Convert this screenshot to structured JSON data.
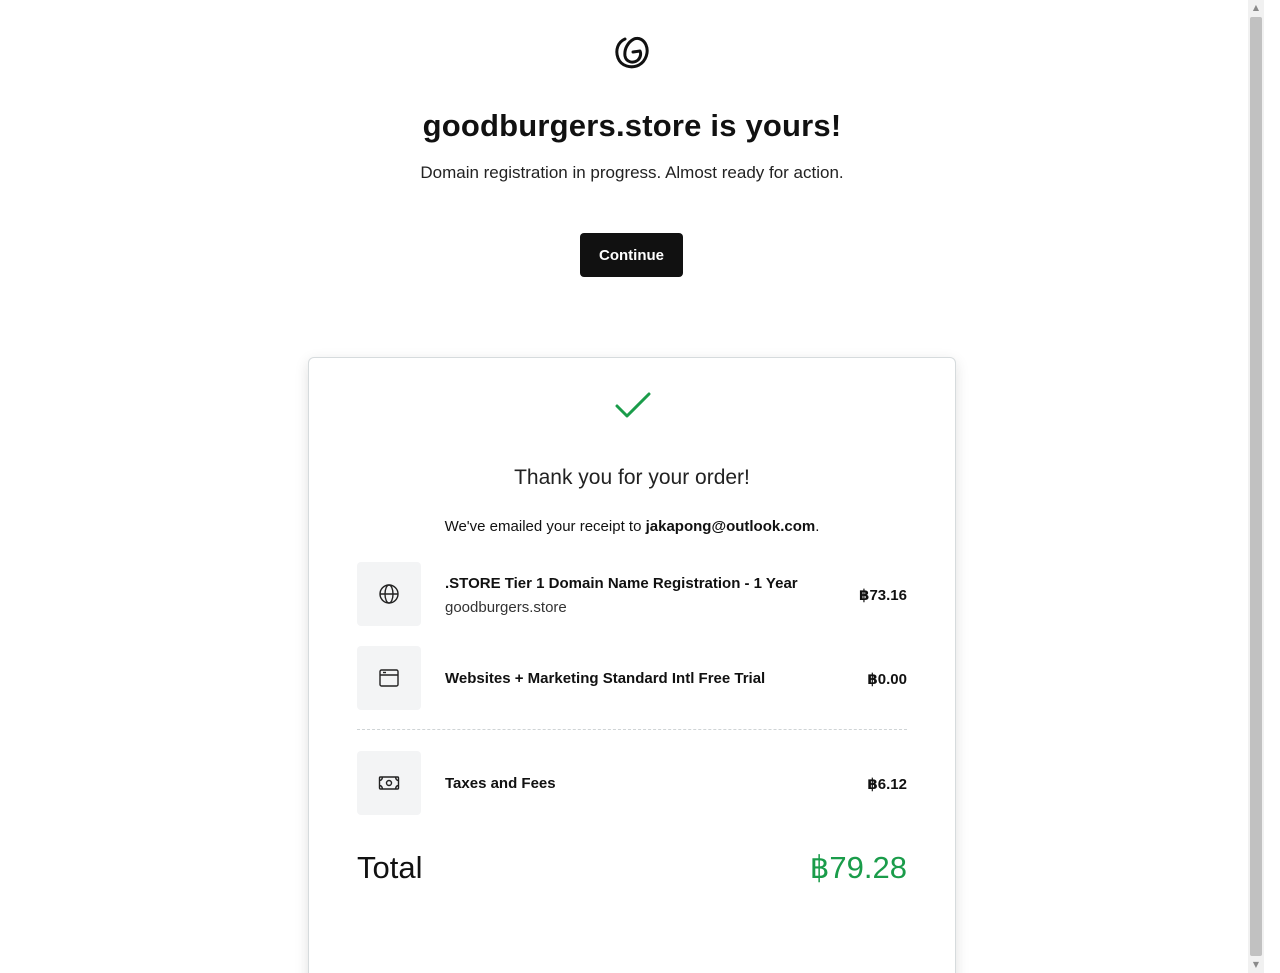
{
  "header": {
    "logo_icon": "godaddy-logo-icon",
    "headline": "goodburgers.store is yours!",
    "subline": "Domain registration in progress. Almost ready for action.",
    "continue_label": "Continue"
  },
  "order": {
    "check_icon": "checkmark-icon",
    "thanks": "Thank you for your order!",
    "receipt_prefix": "We've emailed your receipt to ",
    "receipt_email": "jakapong@outlook.com",
    "receipt_suffix": ".",
    "items": [
      {
        "icon": "globe-icon",
        "title": ".STORE Tier 1 Domain Name Registration - 1 Year",
        "subtitle": "goodburgers.store",
        "price": "฿73.16"
      },
      {
        "icon": "browser-window-icon",
        "title": "Websites + Marketing Standard Intl Free Trial",
        "price": "฿0.00"
      }
    ],
    "taxes": {
      "icon": "cash-icon",
      "title": "Taxes and Fees",
      "price": "฿6.12"
    },
    "total_label": "Total",
    "total_value": "฿79.28",
    "total_color": "#1a9c4a"
  },
  "scrollbar": {
    "up_icon": "scroll-up-arrow-icon",
    "down_icon": "scroll-down-arrow-icon"
  }
}
